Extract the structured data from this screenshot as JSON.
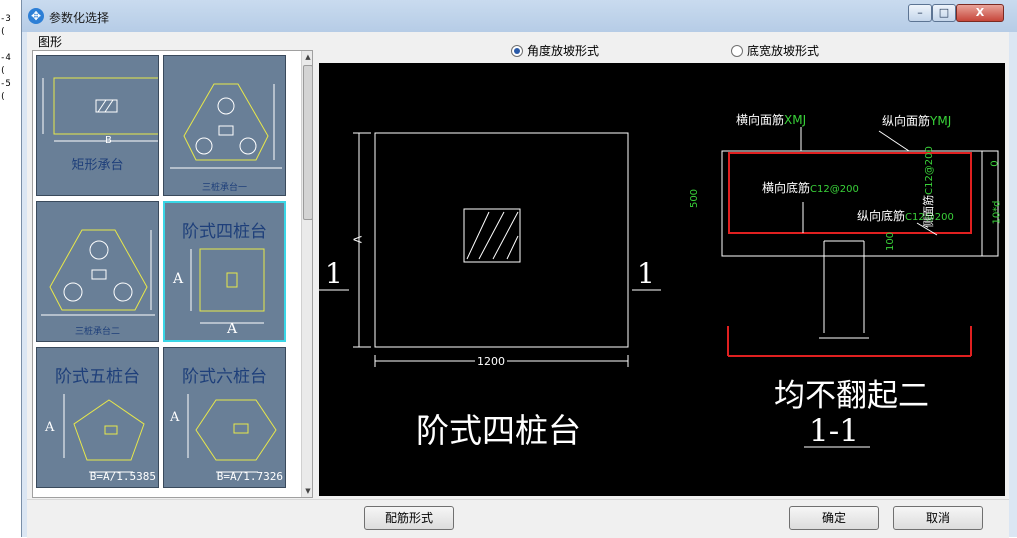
{
  "background_fragment": [
    "-3",
    "(",
    "-4",
    "(",
    "-5",
    "("
  ],
  "window": {
    "title": "参数化选择"
  },
  "titlebar_buttons": {
    "minimize": "–",
    "maximize": "□",
    "close": "X"
  },
  "shapes_panel": {
    "label": "图形",
    "items": [
      {
        "caption": "矩形承台",
        "dim": "B"
      },
      {
        "caption": "三桩承台一"
      },
      {
        "caption": "三桩承台二"
      },
      {
        "caption": "阶式四桩台",
        "dim_a": "A",
        "dim_a2": "A",
        "selected": true
      },
      {
        "caption": "阶式五桩台",
        "dim_a": "A",
        "ratio": "B=A/1.5385"
      },
      {
        "caption": "阶式六桩台",
        "dim_a": "A",
        "ratio": "B=A/1.7326"
      }
    ]
  },
  "radio_options": [
    {
      "label": "角度放坡形式",
      "checked": true
    },
    {
      "label": "底宽放坡形式",
      "checked": false
    }
  ],
  "preview": {
    "plan_title": "阶式四桩台",
    "section_mark": "1",
    "width_dim": "1200",
    "height_dim": "A",
    "section_title": "1-1",
    "section_note": "均不翻起二",
    "labels": {
      "transverse_top": "横向面筋",
      "transverse_top_val": "XMJ",
      "longitudinal_top": "纵向面筋",
      "longitudinal_top_val": "YMJ",
      "transverse_bottom": "横向底筋",
      "transverse_bottom_val": "C12@200",
      "longitudinal_bottom": "纵向底筋",
      "longitudinal_bottom_val": "C12@200",
      "side": "侧面筋",
      "side_val": "C12@200",
      "depth": "500",
      "cover": "100",
      "zero": "0",
      "anchor": "10*d"
    },
    "colors": {
      "line": "#ffffff",
      "rebar": "#e02020",
      "text_green": "#39d239",
      "text_white": "#ffffff"
    }
  },
  "footer": {
    "rebar_button": "配筋形式",
    "ok_button": "确定",
    "cancel_button": "取消"
  }
}
